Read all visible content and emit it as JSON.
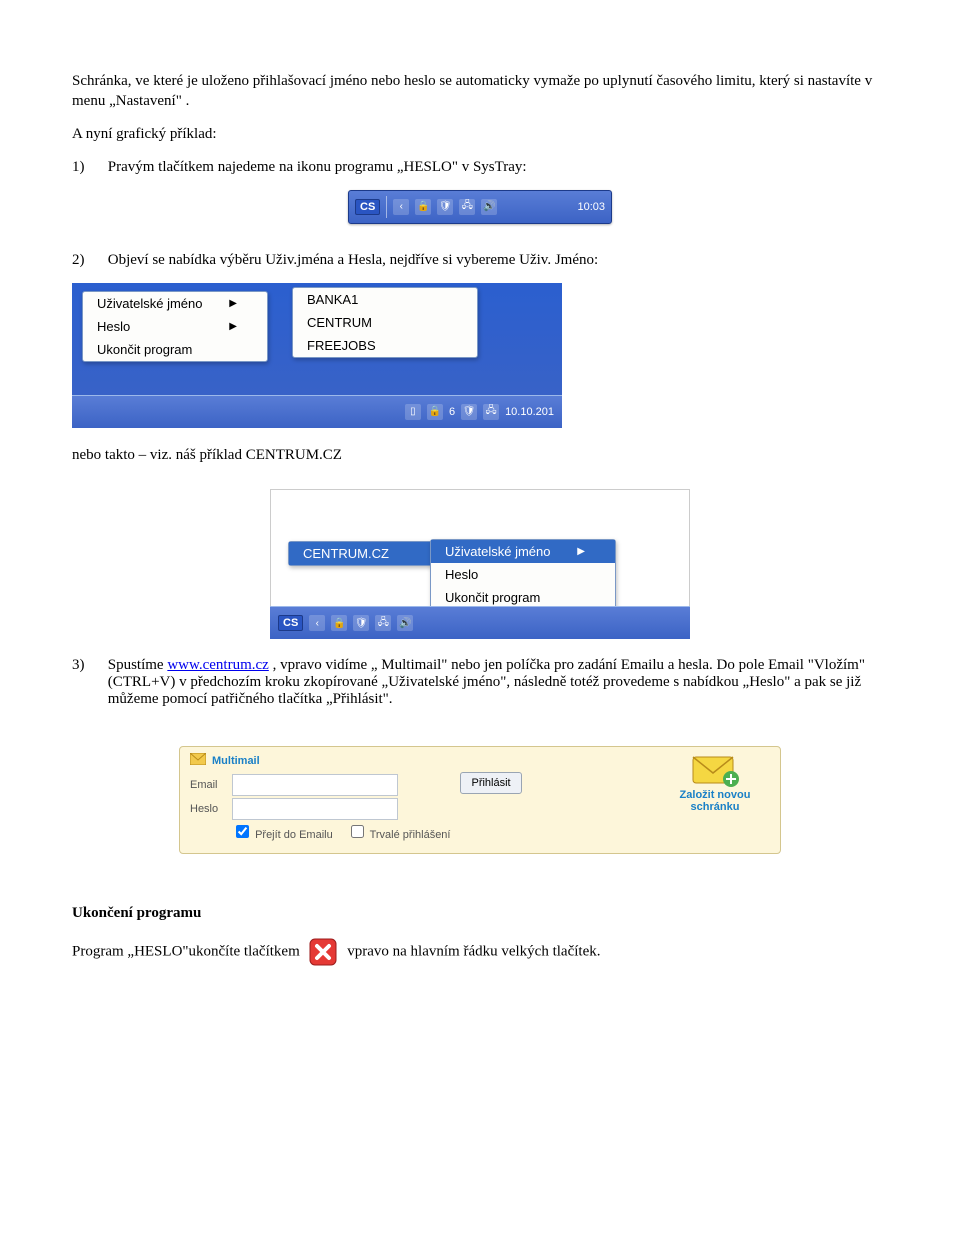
{
  "intro": {
    "p1": "Schránka, ve které je uloženo přihlašovací jméno nebo heslo se automaticky vymaže po uplynutí časového limitu, který si nastavíte v menu „Nastavení\" .",
    "p2": "A nyní grafický příklad:"
  },
  "step1": {
    "num": "1)",
    "text": "Pravým tlačítkem najedeme na ikonu programu „HESLO\" v SysTray:"
  },
  "systray": {
    "lang": "CS",
    "time": "10:03"
  },
  "step2": {
    "num": "2)",
    "text": "Objeví se nabídka výběru Uživ.jména a Hesla,  nejdříve si vybereme  Uživ. Jméno:"
  },
  "menu1": {
    "left": [
      {
        "label": "Uživatelské jméno",
        "arrow": true
      },
      {
        "label": "Heslo",
        "arrow": true
      },
      {
        "label": "Ukončit program",
        "arrow": false
      }
    ],
    "right": [
      "BANKA1",
      "CENTRUM",
      "FREEJOBS"
    ],
    "taskbar_right": "6",
    "taskbar_date": "10.10.201"
  },
  "mid_text": "nebo takto – viz. náš příklad CENTRUM.CZ",
  "menu2": {
    "top_label": "CENTRUM.CZ",
    "right": [
      {
        "label": "Uživatelské jméno",
        "arrow": true
      },
      {
        "label": "Heslo",
        "arrow": false
      },
      {
        "label": "Ukončit program",
        "arrow": false
      }
    ],
    "taskbar_lang": "CS"
  },
  "step3": {
    "num": "3)",
    "pre": "Spustíme ",
    "link": "www.centrum.cz",
    "post": " , vpravo vidíme  „ Multimail\"  nebo jen políčka pro zadání Emailu a hesla. Do pole Email \"Vložím\" (CTRL+V)  v předchozím kroku zkopírované „Uživatelské jméno\", následně totéž provedeme s nabídkou „Heslo\"  a  pak se již můžeme pomocí patřičného tlačítka „Přihlásit\"."
  },
  "multimail": {
    "title": "Multimail",
    "email_label": "Email",
    "heslo_label": "Heslo",
    "login_btn": "Přihlásit",
    "cb1": "Přejít do Emailu",
    "cb2": "Trvalé přihlášení",
    "side1": "Založit novou",
    "side2": "schránku"
  },
  "ending": {
    "title": "Ukončení programu",
    "line_a": "Program „HESLO\"ukončíte tlačítkem",
    "line_b": "vpravo na hlavním řádku velkých tlačítek."
  }
}
